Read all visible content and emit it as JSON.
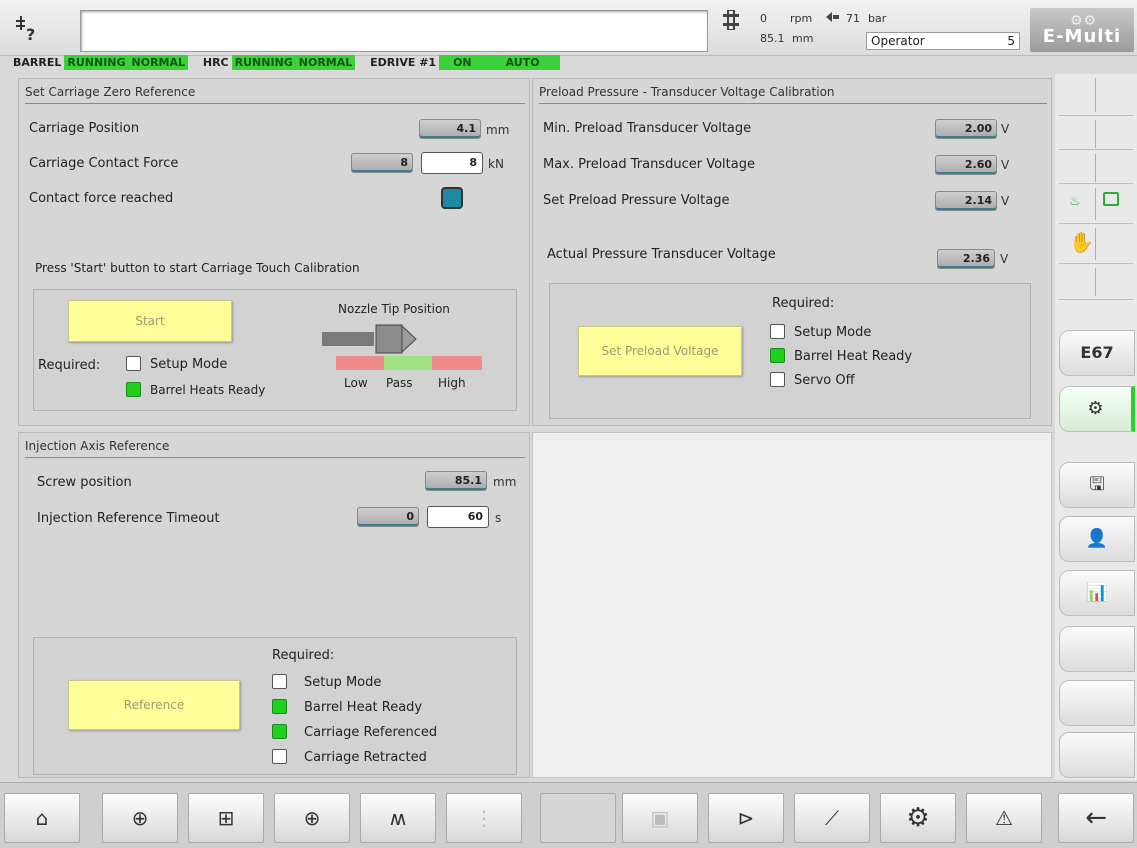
{
  "header": {
    "rpm_value": "0",
    "rpm_unit": "rpm",
    "pressure_value": "71",
    "pressure_unit": "bar",
    "position_value": "85.1",
    "position_unit": "mm",
    "user_level": "Operator",
    "user_level_num": "5",
    "brand": "E-Multi"
  },
  "status_strip": {
    "barrel": "BARREL",
    "barrel_state": "RUNNING",
    "barrel_mode": "NORMAL",
    "hrc": "HRC",
    "hrc_state": "RUNNING",
    "hrc_mode": "NORMAL",
    "edrive": "EDRIVE #1",
    "edrive_state": "ON",
    "edrive_mode": "AUTO"
  },
  "carriage": {
    "title": "Set Carriage Zero Reference",
    "position_label": "Carriage Position",
    "position_value": "4.1",
    "position_unit": "mm",
    "force_label": "Carriage Contact Force",
    "force_actual": "8",
    "force_set": "8",
    "force_unit": "kN",
    "reached_label": "Contact force reached",
    "instruction": "Press 'Start' button to start Carriage Touch Calibration",
    "start_label": "Start",
    "nozzle_label": "Nozzle Tip Position",
    "required_label": "Required:",
    "req_setup": "Setup Mode",
    "req_barrel": "Barrel Heats Ready",
    "scale_low": "Low",
    "scale_pass": "Pass",
    "scale_high": "High"
  },
  "preload": {
    "title": "Preload Pressure - Transducer Voltage Calibration",
    "min_label": "Min. Preload Transducer Voltage",
    "min_value": "2.00",
    "max_label": "Max. Preload Transducer Voltage",
    "max_value": "2.60",
    "set_label": "Set Preload Pressure Voltage",
    "set_value": "2.14",
    "actual_label": "Actual Pressure Transducer Voltage",
    "actual_value": "2.36",
    "unit": "V",
    "button_label": "Set Preload Voltage",
    "required_label": "Required:",
    "req_setup": "Setup Mode",
    "req_barrel": "Barrel Heat Ready",
    "req_servo": "Servo Off"
  },
  "injection": {
    "title": "Injection Axis Reference",
    "screw_label": "Screw position",
    "screw_value": "85.1",
    "screw_unit": "mm",
    "timeout_label": "Injection Reference Timeout",
    "timeout_actual": "0",
    "timeout_set": "60",
    "timeout_unit": "s",
    "button_label": "Reference",
    "required_label": "Required:",
    "req_setup": "Setup Mode",
    "req_barrel": "Barrel Heat Ready",
    "req_carriage_ref": "Carriage Referenced",
    "req_carriage_retract": "Carriage Retracted"
  },
  "sidebar": {
    "code": "E67"
  },
  "colors": {
    "status_green": "#3ad13a",
    "button_yellow": "#ffff9a",
    "accent_teal": "#3a7f8f"
  }
}
